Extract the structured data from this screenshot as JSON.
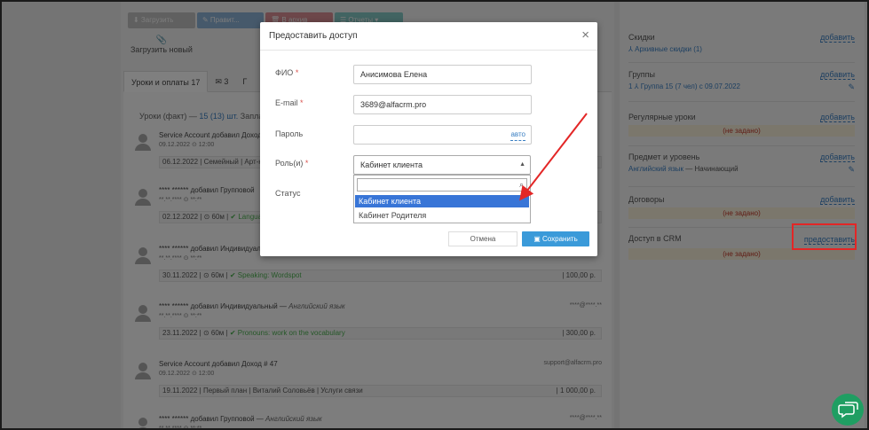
{
  "toolbar": {
    "buttons": [
      "⬇ Загрузить",
      "✎ Правит...",
      "🗑 В архив",
      "☰ Отчеты ▾"
    ],
    "upload_label": "Загрузить новый"
  },
  "tabs": [
    "Уроки и оплаты 17",
    "3",
    "Г"
  ],
  "summary": {
    "label": "Уроки (факт) —",
    "count": "15 (13) шт.",
    "more": "Запла"
  },
  "entries": [
    {
      "title": "Service Account добавил Доход",
      "date": "09.12.2022  ⊙ 12:00",
      "right": "",
      "bar": "06.12.2022 | Семейный | Арт-кл",
      "check": "",
      "amount": ""
    },
    {
      "title": "**** ****** добавил Групповой",
      "date": "**.**.****  ⊙ **:**",
      "right": "",
      "bar": "02.12.2022 | ⊙ 60м |",
      "check": "✔ Language",
      "amount": ""
    },
    {
      "title": "**** ****** добавил Индивидуальный",
      "date": "**.**.****  ⊙ **:**",
      "right": "",
      "bar": "30.11.2022 | ⊙ 60м |",
      "check": "✔ Speaking: Wordspot",
      "amount": "| 100,00 р."
    },
    {
      "title": "**** ****** добавил Индивидуальный —",
      "title_em": "Английский язык",
      "date": "**.**.****  ⊙ **:**",
      "right": "****@****.**",
      "bar": "23.11.2022 | ⊙ 60м |",
      "check": "✔ Pronouns: work on the vocabulary",
      "amount": "| 300,00 р."
    },
    {
      "title": "Service Account добавил Доход # 47",
      "date": "09.12.2022  ⊙ 12:00",
      "right": "support@alfacrm.pro",
      "bar": "19.11.2022 | Первый план | Виталий Соловьёв | Услуги связи",
      "check": "",
      "amount": "| 1 000,00 р."
    },
    {
      "title": "**** ****** добавил Групповой —",
      "title_em": "Английский язык",
      "date": "**.**.****  ⊙ **:**",
      "right": "****@****.**",
      "bar": "",
      "check": "",
      "amount": ""
    }
  ],
  "sidebar": {
    "discounts": {
      "title": "Скидки",
      "add": "добавить",
      "sub": "⅄ Архивные скидки (1)"
    },
    "groups": {
      "title": "Группы",
      "add": "добавить",
      "sub": "1 ⅄ Группа 15 (7 чел) с 09.07.2022"
    },
    "regular": {
      "title": "Регулярные уроки",
      "add": "добавить",
      "warn": "(не задано)"
    },
    "subject": {
      "title": "Предмет и уровень",
      "add": "добавить",
      "sub_link": "Английский язык",
      "sub_text": "— Начинающий"
    },
    "contracts": {
      "title": "Договоры",
      "add": "добавить",
      "warn": "(не задано)"
    },
    "crm": {
      "title": "Доступ в CRM",
      "add": "предоставить",
      "warn": "(не задано)"
    }
  },
  "modal": {
    "title": "Предоставить доступ",
    "close": "×",
    "fio_label": "ФИО",
    "fio_value": "Анисимова Елена",
    "email_label": "E-mail",
    "email_value": "3689@alfacrm.pro",
    "password_label": "Пароль",
    "password_value": "",
    "auto_label": "авто",
    "role_label": "Роль(и)",
    "role_selected": "Кабинет клиента",
    "status_label": "Статус",
    "required_mark": "*",
    "search_value": "",
    "options": [
      "Кабинет клиента",
      "Кабинет Родителя"
    ],
    "cancel": "Отмена",
    "save": "Сохранить"
  },
  "colors": {
    "accent": "#3a9ad9",
    "highlight_red": "#e32626",
    "chat_green": "#1f9e62"
  }
}
